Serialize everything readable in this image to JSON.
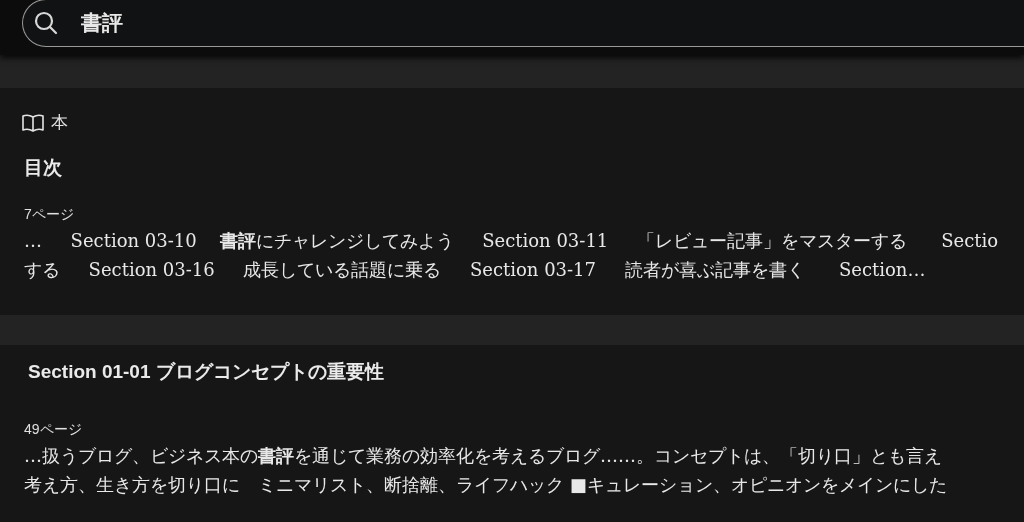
{
  "search": {
    "value": "書評"
  },
  "results": [
    {
      "source": "本",
      "heading": "目次",
      "page": "7ページ",
      "lines": [
        "…     Section 03-10    **書評**にチャレンジしてみよう     Section 03-11     「レビュー記事」をマスターする      Sectio",
        "する     Section 03-16     成長している話題に乗る     Section 03-17     読者が喜ぶ記事を書く      Section…"
      ]
    },
    {
      "heading": "Section 01-01 ブログコンセプトの重要性",
      "page": "49ページ",
      "lines": [
        "…扱うブログ、ビジネス本の**書評**を通じて業務の効率化を考えるブログ……。コンセプトは、「切り口」とも言え",
        "考え方、生き方を切り口に　ミニマリスト、断捨離、ライフハック ■キュレーション、オピニオンをメインにした"
      ]
    }
  ]
}
